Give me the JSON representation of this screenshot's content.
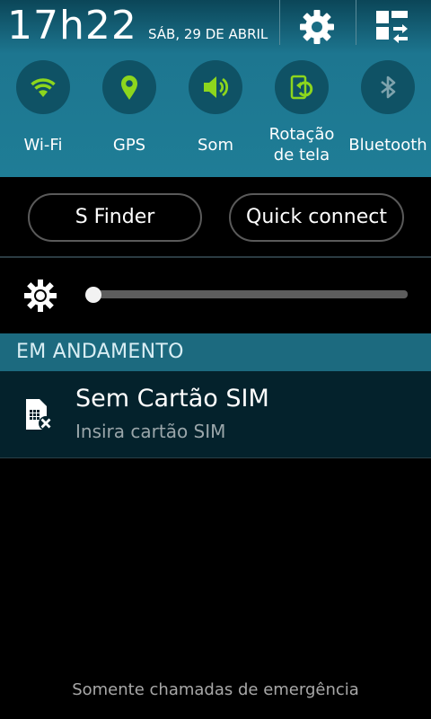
{
  "status": {
    "time": "17h22",
    "date": "SÁB, 29 DE ABRIL"
  },
  "header_buttons": {
    "settings_icon": "gear-icon",
    "edit_icon": "grid-edit-icon"
  },
  "toggles": [
    {
      "label": "Wi-Fi",
      "icon": "wifi-icon",
      "state": "on"
    },
    {
      "label": "GPS",
      "icon": "location-icon",
      "state": "on"
    },
    {
      "label": "Som",
      "icon": "speaker-icon",
      "state": "on"
    },
    {
      "label_line1": "Rotação",
      "label_line2": "de tela",
      "icon": "rotate-icon",
      "state": "on"
    },
    {
      "label": "Bluetooth",
      "icon": "bluetooth-icon",
      "state": "off"
    }
  ],
  "buttons": {
    "s_finder": "S Finder",
    "quick_connect": "Quick connect"
  },
  "brightness": {
    "icon": "sun-icon",
    "level": 0.0
  },
  "ongoing": {
    "header": "EM ANDAMENTO",
    "notification": {
      "title": "Sem Cartão SIM",
      "subtitle": "Insira cartão SIM",
      "icon": "sim-missing-icon"
    }
  },
  "footer": {
    "text": "Somente chamadas de emergência"
  },
  "colors": {
    "active_icon": "#8dd61d",
    "inactive_icon": "#7ea3ad",
    "header_bg": "#1f7d96",
    "section_bg": "#1c6a7f"
  }
}
